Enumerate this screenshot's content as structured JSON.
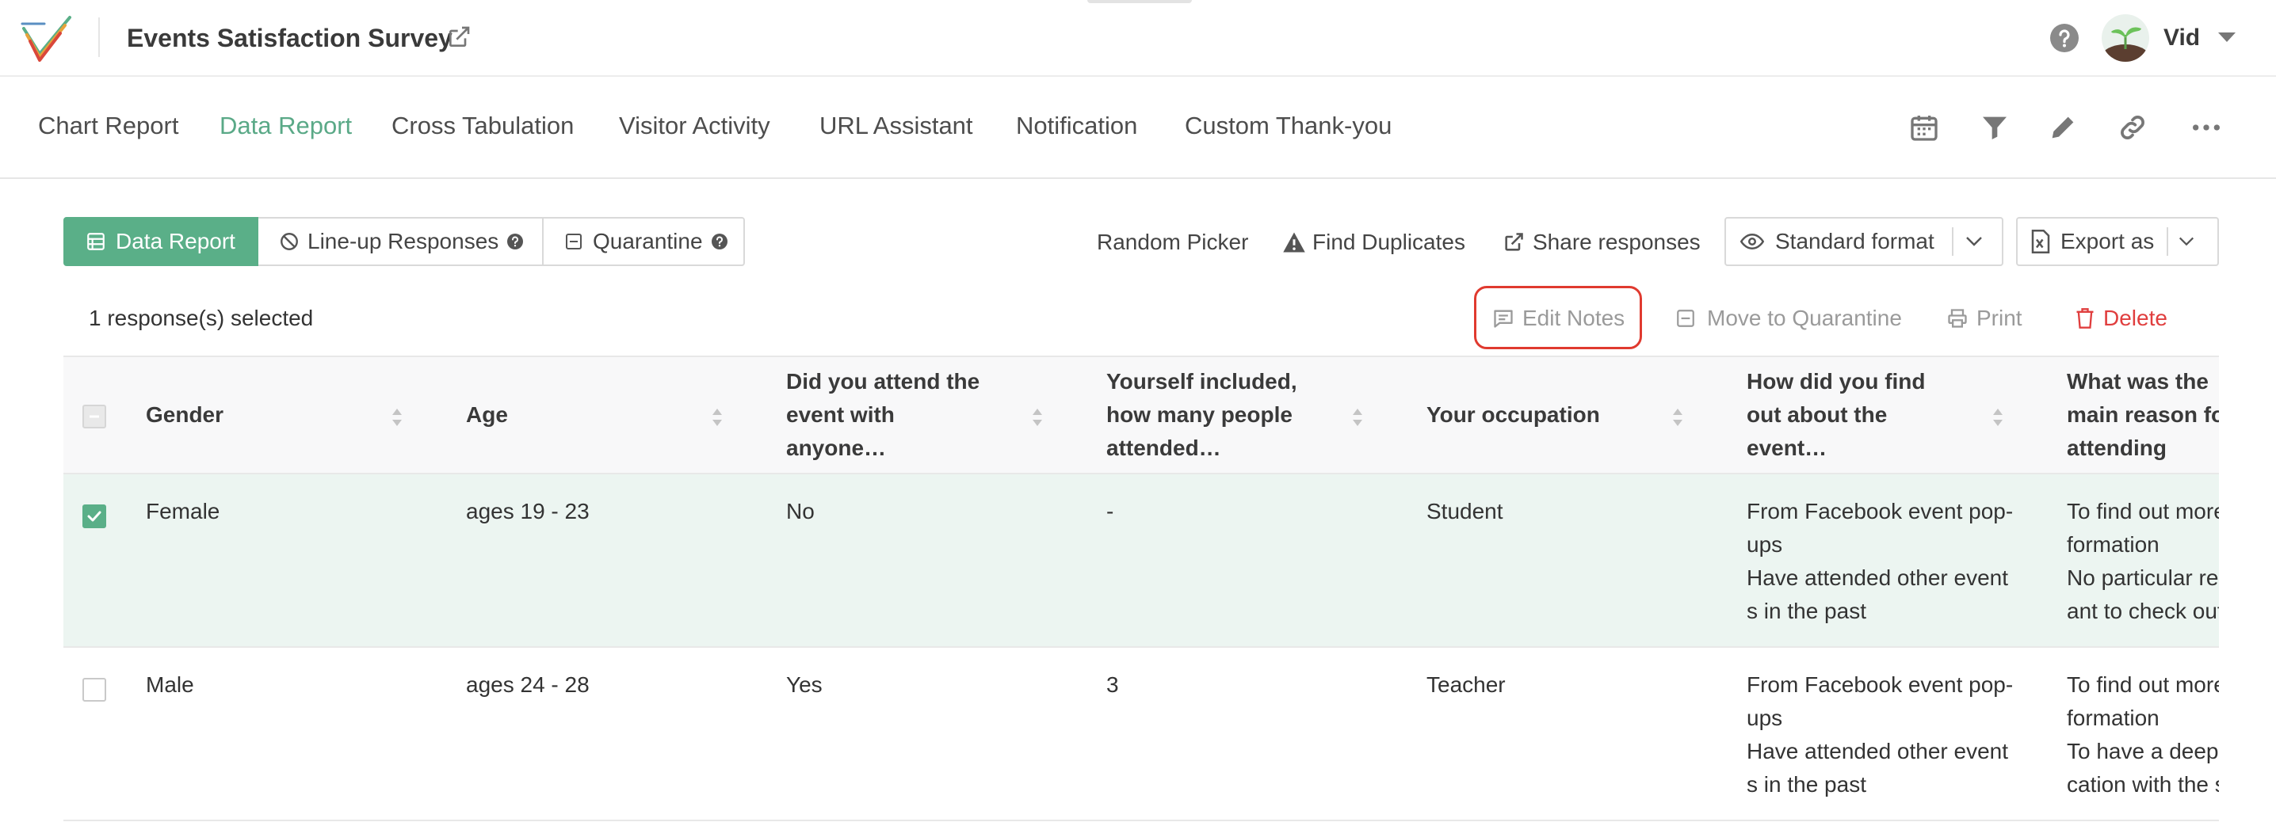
{
  "app": {
    "survey_title": "Events Satisfaction Survey",
    "user_name": "Vid",
    "accent_color": "#5aaf88",
    "highlight_color": "#e03a2f",
    "delete_color": "#e03e3e"
  },
  "report_tabs": [
    {
      "label": "Chart Report",
      "active": false
    },
    {
      "label": "Data Report",
      "active": true
    },
    {
      "label": "Cross Tabulation",
      "active": false
    },
    {
      "label": "Visitor Activity",
      "active": false
    },
    {
      "label": "URL Assistant",
      "active": false
    },
    {
      "label": "Notification",
      "active": false
    },
    {
      "label": "Custom Thank-you",
      "active": false
    }
  ],
  "nav_icons": [
    "calendar-icon",
    "filter-icon",
    "pencil-icon",
    "link-icon",
    "more-icon"
  ],
  "toolbar": {
    "segments": [
      {
        "label": "Data Report",
        "icon": "list-icon",
        "active": true
      },
      {
        "label": "Line-up Responses",
        "icon": "ban-icon",
        "active": false
      },
      {
        "label": "Quarantine",
        "icon": "quarantine-icon",
        "active": false
      }
    ],
    "random_picker": "Random Picker",
    "find_duplicates": "Find Duplicates",
    "share_responses": "Share responses",
    "format_select": "Standard format",
    "export_as": "Export as"
  },
  "selection": {
    "count_text": "1 response(s) selected",
    "edit_notes": "Edit Notes",
    "move_to_quarantine": "Move to Quarantine",
    "print": "Print",
    "delete": "Delete"
  },
  "table": {
    "columns": [
      "Gender",
      "Age",
      "Did you attend the event with anyone…",
      "Yourself included, how many people attended…",
      "Your occupation",
      "How did you find out about the event…",
      "What was the main reason for attending"
    ],
    "rows": [
      {
        "selected": true,
        "cells": [
          "Female",
          "ages 19 - 23",
          "No",
          "-",
          "Student",
          [
            "From Facebook event pop-",
            "ups",
            "Have attended other event",
            "s in the past"
          ],
          [
            "To find out more in",
            "formation",
            "No particular reason, I w",
            "ant to check out"
          ]
        ]
      },
      {
        "selected": false,
        "cells": [
          "Male",
          "ages 24 - 28",
          "Yes",
          "3",
          "Teacher",
          [
            "From Facebook event pop-",
            "ups",
            "Have attended other event",
            "s in the past"
          ],
          [
            "To find out more in",
            "formation",
            "To have a deeper communi",
            "cation with the speaker"
          ]
        ]
      }
    ]
  }
}
